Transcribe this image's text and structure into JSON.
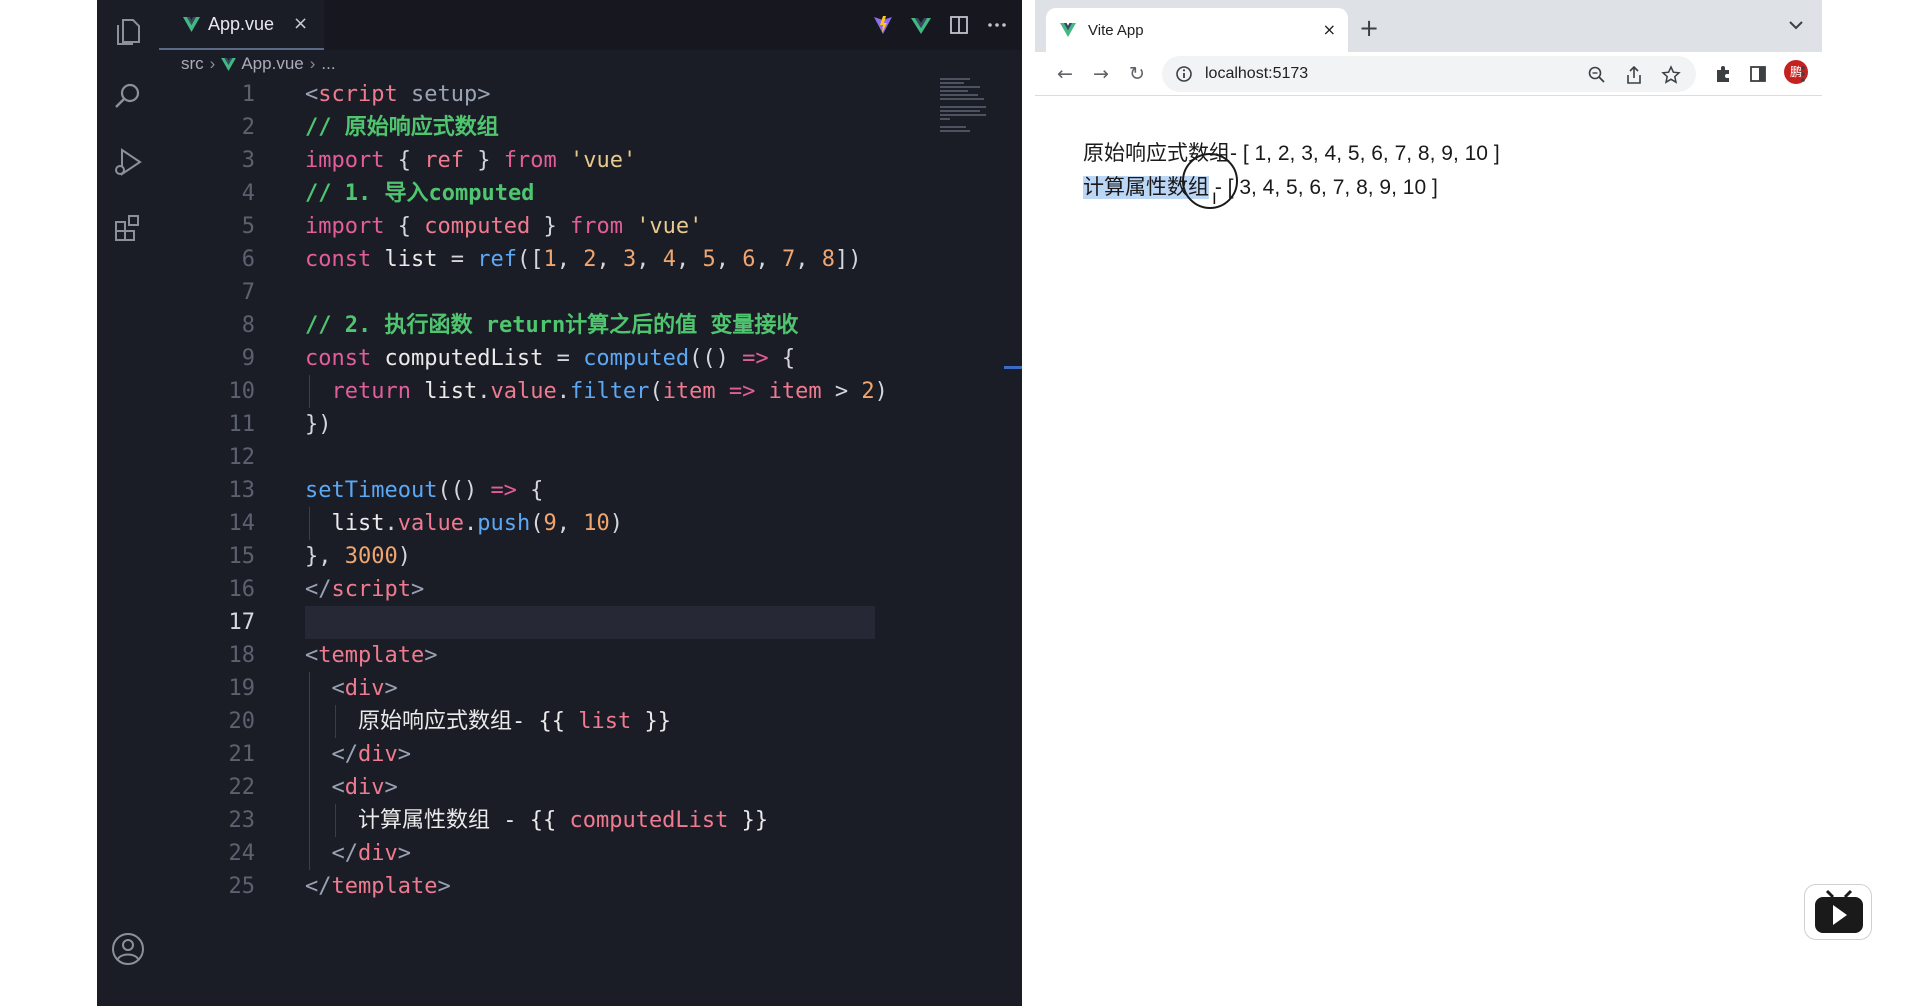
{
  "editor": {
    "tab": {
      "label": "App.vue",
      "close": "×"
    },
    "breadcrumb": {
      "folder": "src",
      "file": "App.vue",
      "more": "..."
    },
    "current_line": "17",
    "lines": [
      {
        "no": "1",
        "tokens": [
          [
            "t-tag",
            "<"
          ],
          [
            "t-tagname",
            "script"
          ],
          [
            "t-punc",
            " "
          ],
          [
            "t-tag",
            "setup"
          ],
          [
            "t-tag",
            ">"
          ]
        ]
      },
      {
        "no": "2",
        "tokens": [
          [
            "t-cm",
            "// 原始响应式数组"
          ]
        ]
      },
      {
        "no": "3",
        "tokens": [
          [
            "t-kw",
            "import"
          ],
          [
            "t-punc",
            " { "
          ],
          [
            "t-prop",
            "ref"
          ],
          [
            "t-punc",
            " } "
          ],
          [
            "t-kw",
            "from"
          ],
          [
            "t-punc",
            " "
          ],
          [
            "t-str",
            "'vue'"
          ]
        ]
      },
      {
        "no": "4",
        "tokens": [
          [
            "t-cm",
            "// 1. 导入computed"
          ]
        ]
      },
      {
        "no": "5",
        "tokens": [
          [
            "t-kw",
            "import"
          ],
          [
            "t-punc",
            " { "
          ],
          [
            "t-prop",
            "computed"
          ],
          [
            "t-punc",
            " } "
          ],
          [
            "t-kw",
            "from"
          ],
          [
            "t-punc",
            " "
          ],
          [
            "t-str",
            "'vue'"
          ]
        ]
      },
      {
        "no": "6",
        "tokens": [
          [
            "t-kw",
            "const"
          ],
          [
            "t-punc",
            " "
          ],
          [
            "t-var",
            "list"
          ],
          [
            "t-punc",
            " = "
          ],
          [
            "t-fn",
            "ref"
          ],
          [
            "t-punc",
            "(["
          ],
          [
            "t-num",
            "1"
          ],
          [
            "t-punc",
            ", "
          ],
          [
            "t-num",
            "2"
          ],
          [
            "t-punc",
            ", "
          ],
          [
            "t-num",
            "3"
          ],
          [
            "t-punc",
            ", "
          ],
          [
            "t-num",
            "4"
          ],
          [
            "t-punc",
            ", "
          ],
          [
            "t-num",
            "5"
          ],
          [
            "t-punc",
            ", "
          ],
          [
            "t-num",
            "6"
          ],
          [
            "t-punc",
            ", "
          ],
          [
            "t-num",
            "7"
          ],
          [
            "t-punc",
            ", "
          ],
          [
            "t-num",
            "8"
          ],
          [
            "t-punc",
            "])"
          ]
        ]
      },
      {
        "no": "7",
        "tokens": []
      },
      {
        "no": "8",
        "tokens": [
          [
            "t-cm",
            "// 2. 执行函数 return计算之后的值 变量接收"
          ]
        ]
      },
      {
        "no": "9",
        "tokens": [
          [
            "t-kw",
            "const"
          ],
          [
            "t-punc",
            " "
          ],
          [
            "t-var",
            "computedList"
          ],
          [
            "t-punc",
            " = "
          ],
          [
            "t-fn",
            "computed"
          ],
          [
            "t-punc",
            "(() "
          ],
          [
            "t-kw",
            "=>"
          ],
          [
            "t-punc",
            " {"
          ]
        ]
      },
      {
        "no": "10",
        "tokens": [
          [
            "t-punc",
            "  "
          ],
          [
            "t-kw",
            "return"
          ],
          [
            "t-punc",
            " "
          ],
          [
            "t-var",
            "list"
          ],
          [
            "t-punc",
            "."
          ],
          [
            "t-prop",
            "value"
          ],
          [
            "t-punc",
            "."
          ],
          [
            "t-fn",
            "filter"
          ],
          [
            "t-punc",
            "("
          ],
          [
            "t-prop",
            "item"
          ],
          [
            "t-punc",
            " "
          ],
          [
            "t-kw",
            "=>"
          ],
          [
            "t-punc",
            " "
          ],
          [
            "t-prop",
            "item"
          ],
          [
            "t-punc",
            " > "
          ],
          [
            "t-num",
            "2"
          ],
          [
            "t-punc",
            ")"
          ]
        ]
      },
      {
        "no": "11",
        "tokens": [
          [
            "t-punc",
            "})"
          ]
        ]
      },
      {
        "no": "12",
        "tokens": []
      },
      {
        "no": "13",
        "tokens": [
          [
            "t-fn",
            "setTimeout"
          ],
          [
            "t-punc",
            "(() "
          ],
          [
            "t-kw",
            "=>"
          ],
          [
            "t-punc",
            " {"
          ]
        ]
      },
      {
        "no": "14",
        "tokens": [
          [
            "t-punc",
            "  "
          ],
          [
            "t-var",
            "list"
          ],
          [
            "t-punc",
            "."
          ],
          [
            "t-prop",
            "value"
          ],
          [
            "t-punc",
            "."
          ],
          [
            "t-fn",
            "push"
          ],
          [
            "t-punc",
            "("
          ],
          [
            "t-num",
            "9"
          ],
          [
            "t-punc",
            ", "
          ],
          [
            "t-num",
            "10"
          ],
          [
            "t-punc",
            ")"
          ]
        ]
      },
      {
        "no": "15",
        "tokens": [
          [
            "t-punc",
            "}, "
          ],
          [
            "t-num",
            "3000"
          ],
          [
            "t-punc",
            ")"
          ]
        ]
      },
      {
        "no": "16",
        "tokens": [
          [
            "t-tag",
            "</"
          ],
          [
            "t-tagname",
            "script"
          ],
          [
            "t-tag",
            ">"
          ]
        ]
      },
      {
        "no": "17",
        "tokens": []
      },
      {
        "no": "18",
        "tokens": [
          [
            "t-tag",
            "<"
          ],
          [
            "t-tagname",
            "template"
          ],
          [
            "t-tag",
            ">"
          ]
        ]
      },
      {
        "no": "19",
        "tokens": [
          [
            "t-punc",
            "  "
          ],
          [
            "t-tag",
            "<"
          ],
          [
            "t-tagname",
            "div"
          ],
          [
            "t-tag",
            ">"
          ]
        ]
      },
      {
        "no": "20",
        "tokens": [
          [
            "t-punc",
            "    "
          ],
          [
            "t-var",
            "原始响应式数组- {{ "
          ],
          [
            "t-name",
            "list"
          ],
          [
            "t-var",
            " }}"
          ]
        ]
      },
      {
        "no": "21",
        "tokens": [
          [
            "t-punc",
            "  "
          ],
          [
            "t-tag",
            "</"
          ],
          [
            "t-tagname",
            "div"
          ],
          [
            "t-tag",
            ">"
          ]
        ]
      },
      {
        "no": "22",
        "tokens": [
          [
            "t-punc",
            "  "
          ],
          [
            "t-tag",
            "<"
          ],
          [
            "t-tagname",
            "div"
          ],
          [
            "t-tag",
            ">"
          ]
        ]
      },
      {
        "no": "23",
        "tokens": [
          [
            "t-punc",
            "    "
          ],
          [
            "t-var",
            "计算属性数组 - {{ "
          ],
          [
            "t-name",
            "computedList"
          ],
          [
            "t-var",
            " }}"
          ]
        ]
      },
      {
        "no": "24",
        "tokens": [
          [
            "t-punc",
            "  "
          ],
          [
            "t-tag",
            "</"
          ],
          [
            "t-tagname",
            "div"
          ],
          [
            "t-tag",
            ">"
          ]
        ]
      },
      {
        "no": "25",
        "tokens": [
          [
            "t-tag",
            "</"
          ],
          [
            "t-tagname",
            "template"
          ],
          [
            "t-tag",
            ">"
          ]
        ]
      }
    ]
  },
  "browser": {
    "tab_title": "Vite App",
    "tab_close": "×",
    "new_tab": "+",
    "url": "localhost:5173",
    "profile_initial": "鹏",
    "page": {
      "line1": "原始响应式数组- [ 1, 2, 3, 4, 5, 6, 7, 8, 9, 10 ]",
      "line2_selected": "计算属性数组",
      "line2_rest": " - [ 3, 4, 5, 6, 7, 8, 9, 10 ]"
    }
  },
  "colors": {
    "editor_bg": "#1b1d26",
    "vue_green": "#42b883",
    "selection": "#bcd6f5"
  }
}
